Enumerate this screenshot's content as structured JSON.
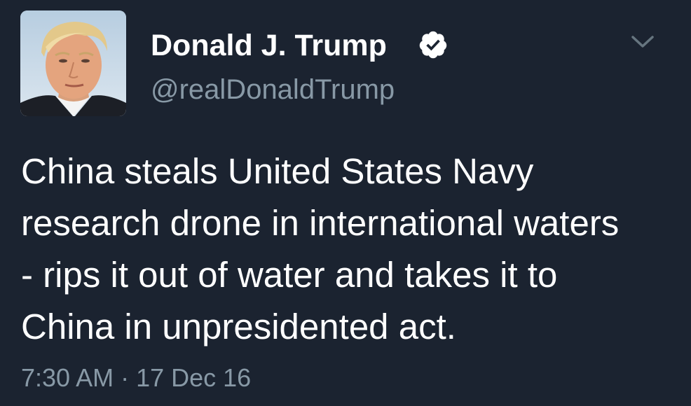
{
  "tweet": {
    "author": {
      "display_name": "Donald J. Trump",
      "handle": "@realDonaldTrump",
      "verified": true,
      "avatar_icon": "profile-photo"
    },
    "text_lines": [
      "China steals United States Navy",
      "research drone in international waters",
      "- rips it out of water and takes it to",
      "China in unpresidented act."
    ],
    "timestamp": "7:30 AM · 17 Dec 16",
    "menu_icon": "chevron-down-icon"
  },
  "colors": {
    "background": "#1b2330",
    "primary_text": "#ffffff",
    "secondary_text": "#8899a6"
  }
}
